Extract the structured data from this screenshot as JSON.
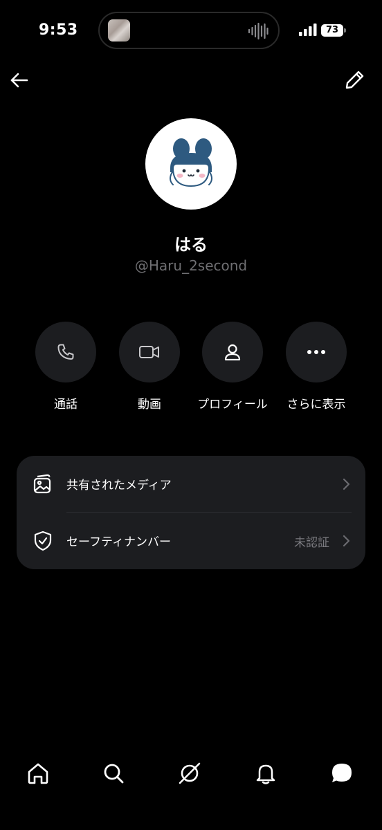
{
  "status_bar": {
    "time": "9:53",
    "battery": "73"
  },
  "profile": {
    "display_name": "はる",
    "handle": "@Haru_2second"
  },
  "actions": [
    {
      "label": "通話",
      "icon": "phone-icon"
    },
    {
      "label": "動画",
      "icon": "video-icon"
    },
    {
      "label": "プロフィール",
      "icon": "person-icon"
    },
    {
      "label": "さらに表示",
      "icon": "more-icon"
    }
  ],
  "settings": [
    {
      "label": "共有されたメディア",
      "value": "",
      "icon": "media-icon"
    },
    {
      "label": "セーフティナンバー",
      "value": "未認証",
      "icon": "shield-check-icon"
    }
  ],
  "tab_bar": [
    "home-icon",
    "search-icon",
    "grok-icon",
    "bell-icon",
    "messages-icon"
  ],
  "colors": {
    "background": "#000000",
    "surface": "#1c1d20",
    "muted_text": "#6f6f72",
    "avatar_character": "#2e5a80"
  }
}
